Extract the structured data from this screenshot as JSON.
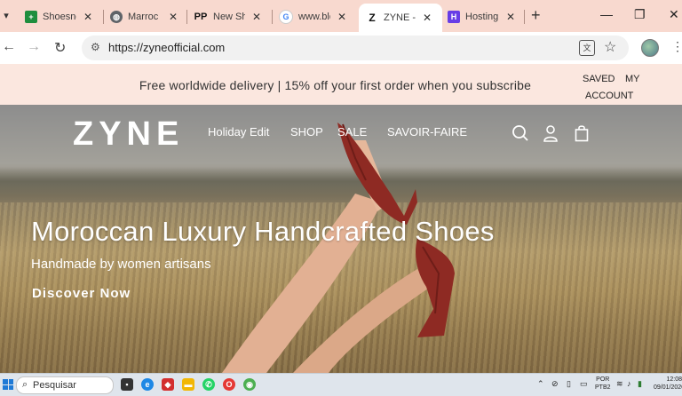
{
  "browser": {
    "tabs": [
      {
        "label": "Shoesne",
        "favicon": "sheets-icon",
        "color": "#1e8e3e"
      },
      {
        "label": "Marroc",
        "favicon": "globe-icon",
        "color": "#5f6368"
      },
      {
        "label": "New Sh",
        "favicon": "pp-icon",
        "color": "#111111"
      },
      {
        "label": "www.blo",
        "favicon": "google-icon",
        "color": "#4285f4"
      },
      {
        "label": "ZYNE - I",
        "favicon": "zyne-icon",
        "color": "#111111",
        "active": true
      },
      {
        "label": "Hosting",
        "favicon": "hostinger-icon",
        "color": "#673de6"
      }
    ],
    "tab_close": "✕",
    "new_tab": "+",
    "url": "https://zyneofficial.com"
  },
  "site": {
    "announcement": "Free worldwide delivery | 15% off your first order when you subscribe",
    "account": {
      "saved": "SAVED",
      "my": "MY",
      "account": "ACCOUNT"
    },
    "logo": "ZYNE",
    "nav": [
      "Holiday Edit",
      "SHOP",
      "SALE",
      "SAVOIR-FAIRE"
    ],
    "hero": {
      "headline": "Moroccan Luxury Handcrafted Shoes",
      "subheadline": "Handmade by women artisans",
      "cta": "Discover Now"
    },
    "accent_color": "#8e2a23"
  },
  "taskbar": {
    "search_placeholder": "Pesquisar",
    "language": "POR",
    "keyboard": "PTB2",
    "time": "12:08",
    "date": "09/01/2026"
  }
}
